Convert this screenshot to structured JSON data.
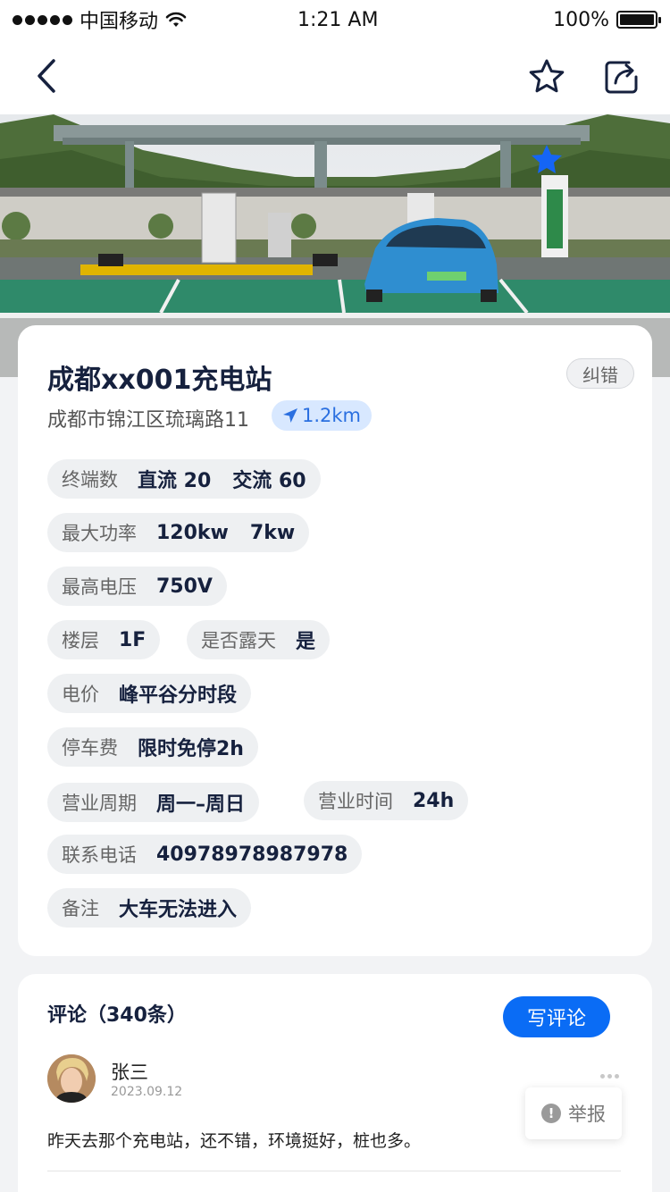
{
  "status_bar": {
    "carrier": "中国移动",
    "time": "1:21 AM",
    "battery": "100%"
  },
  "nav": {
    "back_icon": "chevron-left-icon",
    "favorite_icon": "star-outline-icon",
    "share_icon": "share-icon"
  },
  "station": {
    "name": "成都xx001充电站",
    "report_label": "纠错",
    "address": "成都市锦江区琉璃路11",
    "distance": "1.2km",
    "favorite_color": "#1565f5",
    "attributes": {
      "terminals": {
        "label": "终端数",
        "dc": "直流 20",
        "ac": "交流 60"
      },
      "max_power": {
        "label": "最大功率",
        "dc": "120kw",
        "ac": "7kw"
      },
      "max_voltage": {
        "label": "最高电压",
        "value": "750V"
      },
      "floor": {
        "label": "楼层",
        "value": "1F"
      },
      "outdoor": {
        "label": "是否露天",
        "value": "是"
      },
      "price": {
        "label": "电价",
        "value": "峰平谷分时段"
      },
      "parking_fee": {
        "label": "停车费",
        "value": "限时免停2h"
      },
      "business_days": {
        "label": "营业周期",
        "value": "周一–周日"
      },
      "business_hours": {
        "label": "营业时间",
        "value": "24h"
      },
      "phone": {
        "label": "联系电话",
        "value": "40978978987978"
      },
      "note": {
        "label": "备注",
        "value": "大车无法进入"
      }
    }
  },
  "comments": {
    "title": "评论（340条）",
    "write_button": "写评论",
    "items": [
      {
        "user": "张三",
        "date": "2023.09.12",
        "text": "昨天去那个充电站，还不错，环境挺好，桩也多。",
        "report_label": "举报"
      }
    ]
  },
  "colors": {
    "accent": "#0a6cf5",
    "distance_bg": "#d8e8ff",
    "chip_bg": "#eef0f2"
  }
}
